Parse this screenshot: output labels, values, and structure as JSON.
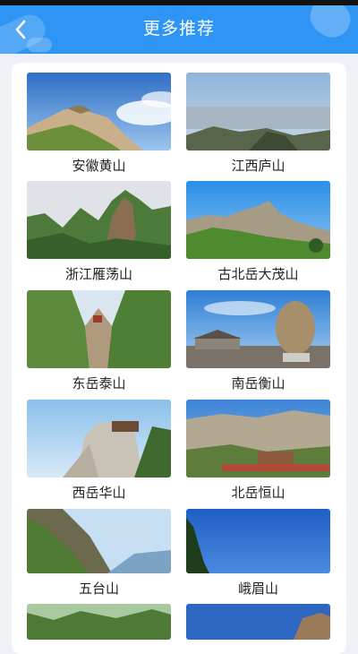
{
  "header": {
    "title": "更多推荐",
    "back_icon": "chevron-left-icon",
    "background": "#2f95f4"
  },
  "recommendations": [
    {
      "name": "安徽黄山"
    },
    {
      "name": "江西庐山"
    },
    {
      "name": "浙江雁荡山"
    },
    {
      "name": "古北岳大茂山"
    },
    {
      "name": "东岳泰山"
    },
    {
      "name": "南岳衡山"
    },
    {
      "name": "西岳华山"
    },
    {
      "name": "北岳恒山"
    },
    {
      "name": "五台山"
    },
    {
      "name": "峨眉山"
    },
    {
      "name": ""
    },
    {
      "name": ""
    }
  ]
}
